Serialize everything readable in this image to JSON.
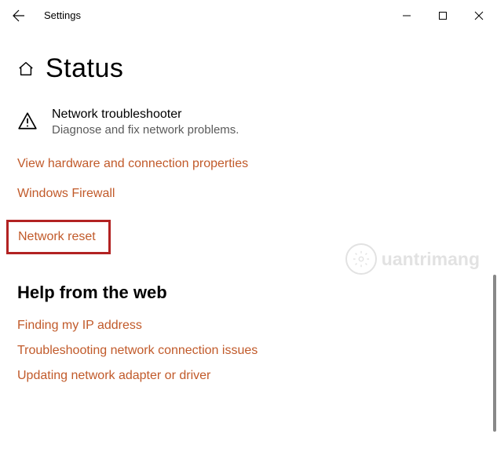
{
  "window": {
    "app_title": "Settings"
  },
  "page": {
    "title": "Status"
  },
  "troubleshooter": {
    "title": "Network troubleshooter",
    "subtitle": "Diagnose and fix network problems."
  },
  "links": {
    "hardware": "View hardware and connection properties",
    "firewall": "Windows Firewall",
    "reset": "Network reset"
  },
  "help": {
    "heading": "Help from the web",
    "items": [
      "Finding my IP address",
      "Troubleshooting network connection issues",
      "Updating network adapter or driver"
    ]
  },
  "watermark": {
    "text": "uantrimang"
  }
}
